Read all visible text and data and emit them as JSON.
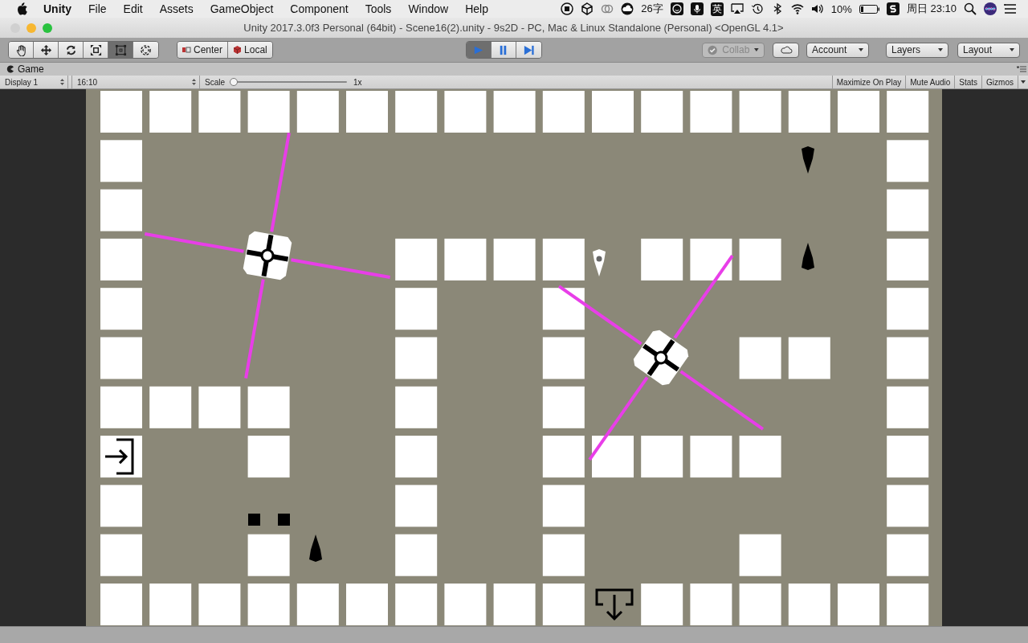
{
  "menubar": {
    "items": [
      {
        "label": "Unity",
        "bold": true
      },
      {
        "label": "File",
        "bold": false
      },
      {
        "label": "Edit",
        "bold": false
      },
      {
        "label": "Assets",
        "bold": false
      },
      {
        "label": "GameObject",
        "bold": false
      },
      {
        "label": "Component",
        "bold": false
      },
      {
        "label": "Tools",
        "bold": false
      },
      {
        "label": "Window",
        "bold": false
      },
      {
        "label": "Help",
        "bold": false
      }
    ],
    "status": [
      {
        "kind": "record"
      },
      {
        "kind": "unity"
      },
      {
        "kind": "cc"
      },
      {
        "kind": "cloud"
      },
      {
        "kind": "text",
        "label": "26字"
      },
      {
        "kind": "smile"
      },
      {
        "kind": "mic"
      },
      {
        "kind": "boxed",
        "label": "英"
      },
      {
        "kind": "airplay"
      },
      {
        "kind": "clock"
      },
      {
        "kind": "bluetooth"
      },
      {
        "kind": "wifi"
      },
      {
        "kind": "volume"
      },
      {
        "kind": "text",
        "label": "10%"
      },
      {
        "kind": "battery"
      },
      {
        "kind": "sapp"
      },
      {
        "kind": "text",
        "label": "周日 23:10"
      },
      {
        "kind": "search"
      },
      {
        "kind": "siri"
      },
      {
        "kind": "list"
      }
    ]
  },
  "window": {
    "title": "Unity 2017.3.0f3 Personal (64bit) - Scene16(2).unity - 9s2D - PC, Mac & Linux Standalone (Personal) <OpenGL 4.1>"
  },
  "toolbar": {
    "tools": [
      {
        "kind": "hand",
        "selected": false
      },
      {
        "kind": "move",
        "selected": false
      },
      {
        "kind": "rotate",
        "selected": false
      },
      {
        "kind": "scale",
        "selected": false
      },
      {
        "kind": "rect",
        "selected": true
      },
      {
        "kind": "transform",
        "selected": false
      }
    ],
    "pivot": [
      {
        "label": "Center"
      },
      {
        "label": "Local"
      }
    ],
    "playback": [
      {
        "kind": "play",
        "selected": true
      },
      {
        "kind": "pause",
        "selected": false
      },
      {
        "kind": "step",
        "selected": false
      }
    ],
    "collab": {
      "label": "Collab",
      "disabled": true
    },
    "account": "Account",
    "layers": "Layers",
    "layout": "Layout"
  },
  "game": {
    "tab": "Game",
    "display": "Display 1",
    "aspect": "16:10",
    "scale_label": "Scale",
    "scale": {
      "level": 0.0
    },
    "scale_value": "1x",
    "toggles": [
      {
        "label": "Maximize On Play"
      },
      {
        "label": "Mute Audio"
      },
      {
        "label": "Stats"
      },
      {
        "label": "Gizmos"
      }
    ]
  }
}
